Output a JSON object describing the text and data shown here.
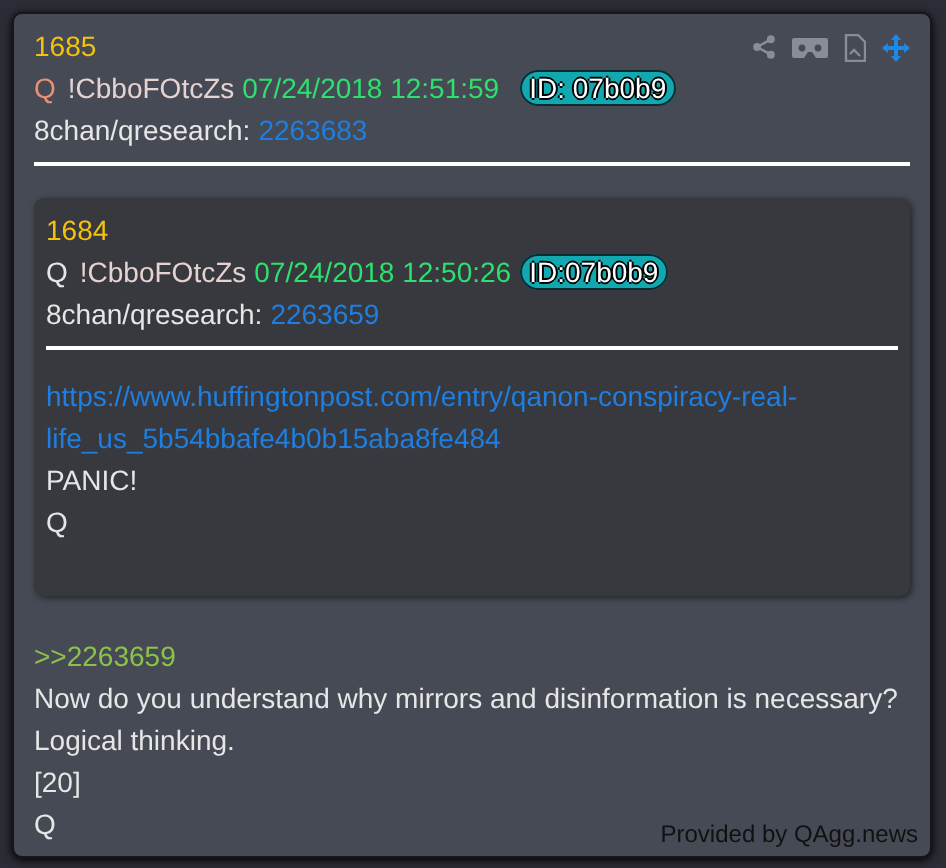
{
  "post": {
    "number": "1685",
    "author": "Q",
    "tripcode": "!CbboFOtcZs",
    "timestamp": "07/24/2018 12:51:59",
    "id_badge": "ID: 07b0b9",
    "board": "8chan/qresearch:",
    "post_link": "2263683",
    "quote": {
      "number": "1684",
      "author": "Q",
      "tripcode": "!CbboFOtcZs",
      "timestamp": "07/24/2018 12:50:26",
      "id_badge": "ID:07b0b9",
      "board": "8chan/qresearch:",
      "post_link": "2263659",
      "body": [
        {
          "kind": "link",
          "text": "https://www.huffingtonpost.com/entry/qanon-conspiracy-real-life_us_5b54bbafe4b0b15aba8fe484"
        },
        {
          "kind": "text",
          "text": "PANIC!"
        },
        {
          "kind": "text",
          "text": "Q"
        }
      ]
    },
    "body": [
      {
        "kind": "reply",
        "text": ">>2263659"
      },
      {
        "kind": "text",
        "text": "Now do you understand why mirrors and disinformation is necessary?"
      },
      {
        "kind": "text",
        "text": "Logical thinking."
      },
      {
        "kind": "text",
        "text": "[20]"
      },
      {
        "kind": "text",
        "text": "Q"
      }
    ],
    "footer": "Provided by QAgg.news"
  }
}
